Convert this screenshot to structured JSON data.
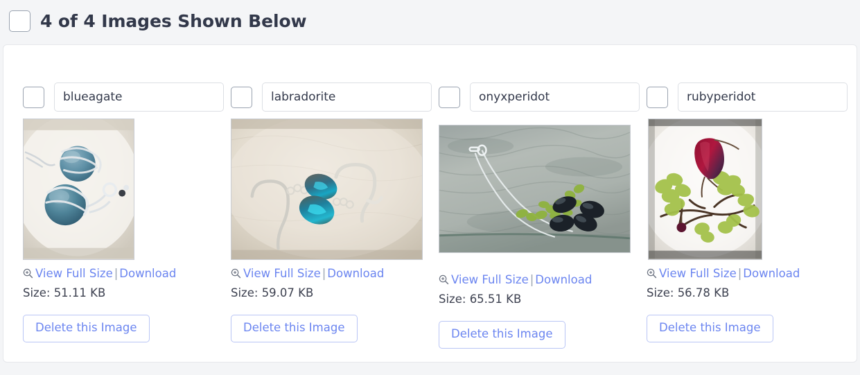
{
  "header": {
    "title": "4 of 4 Images Shown Below",
    "select_all_checked": false
  },
  "colors": {
    "page_background": "#f4f5f7",
    "card_background": "#ffffff",
    "card_border": "#e6e8ec",
    "title_text": "#32384a",
    "link_blue": "#6b85f0",
    "button_border": "#b9c5f5",
    "checkbox_border": "#9aa3b0",
    "input_border": "#dcdfe4",
    "body_text": "#3d4150"
  },
  "labels": {
    "view_full_size": "View Full Size",
    "download": "Download",
    "separator": "|",
    "size_prefix": "Size:",
    "delete_button": "Delete this Image",
    "zoom_icon": "zoom-in-magnifier-icon",
    "name_placeholder": "Image name"
  },
  "images": [
    {
      "name": "blueagate",
      "size": "51.11 KB",
      "checked": false,
      "alt": "Blue agate wire-wrapped earrings on white cloth"
    },
    {
      "name": "labradorite",
      "size": "59.07 KB",
      "checked": false,
      "alt": "Labradorite teardrop earrings on beige fabric"
    },
    {
      "name": "onyxperidot",
      "size": "65.51 KB",
      "checked": false,
      "alt": "Onyx and peridot necklace on textured glass"
    },
    {
      "name": "rubyperidot",
      "size": "56.78 KB",
      "checked": false,
      "alt": "Ruby and peridot branch necklace on white fleece"
    }
  ]
}
